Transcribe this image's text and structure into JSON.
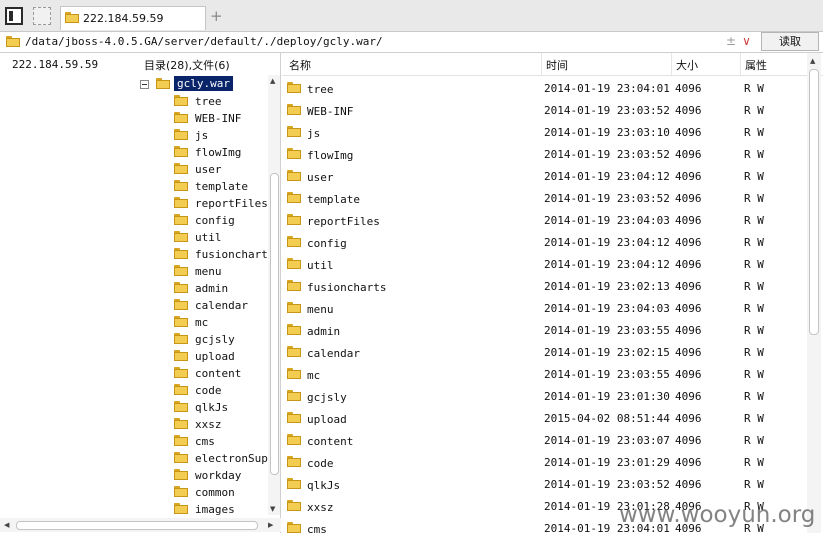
{
  "tab": {
    "title": "222.184.59.59"
  },
  "address": {
    "path": "/data/jboss-4.0.5.GA/server/default/./deploy/gcly.war/",
    "read_button": "读取"
  },
  "tree": {
    "host": "222.184.59.59",
    "counts": "目录(28),文件(6)",
    "root": "gcly.war",
    "items": [
      "tree",
      "WEB-INF",
      "js",
      "flowImg",
      "user",
      "template",
      "reportFiles",
      "config",
      "util",
      "fusioncharts",
      "menu",
      "admin",
      "calendar",
      "mc",
      "gcjsly",
      "upload",
      "content",
      "code",
      "qlkJs",
      "xxsz",
      "cms",
      "electronSuper",
      "workday",
      "common",
      "images"
    ]
  },
  "columns": {
    "name": "名称",
    "time": "时间",
    "size": "大小",
    "attr": "属性"
  },
  "files": [
    {
      "name": "tree",
      "time": "2014-01-19 23:04:01",
      "size": "4096",
      "attr": "R W"
    },
    {
      "name": "WEB-INF",
      "time": "2014-01-19 23:03:52",
      "size": "4096",
      "attr": "R W"
    },
    {
      "name": "js",
      "time": "2014-01-19 23:03:10",
      "size": "4096",
      "attr": "R W"
    },
    {
      "name": "flowImg",
      "time": "2014-01-19 23:03:52",
      "size": "4096",
      "attr": "R W"
    },
    {
      "name": "user",
      "time": "2014-01-19 23:04:12",
      "size": "4096",
      "attr": "R W"
    },
    {
      "name": "template",
      "time": "2014-01-19 23:03:52",
      "size": "4096",
      "attr": "R W"
    },
    {
      "name": "reportFiles",
      "time": "2014-01-19 23:04:03",
      "size": "4096",
      "attr": "R W"
    },
    {
      "name": "config",
      "time": "2014-01-19 23:04:12",
      "size": "4096",
      "attr": "R W"
    },
    {
      "name": "util",
      "time": "2014-01-19 23:04:12",
      "size": "4096",
      "attr": "R W"
    },
    {
      "name": "fusioncharts",
      "time": "2014-01-19 23:02:13",
      "size": "4096",
      "attr": "R W"
    },
    {
      "name": "menu",
      "time": "2014-01-19 23:04:03",
      "size": "4096",
      "attr": "R W"
    },
    {
      "name": "admin",
      "time": "2014-01-19 23:03:55",
      "size": "4096",
      "attr": "R W"
    },
    {
      "name": "calendar",
      "time": "2014-01-19 23:02:15",
      "size": "4096",
      "attr": "R W"
    },
    {
      "name": "mc",
      "time": "2014-01-19 23:03:55",
      "size": "4096",
      "attr": "R W"
    },
    {
      "name": "gcjsly",
      "time": "2014-01-19 23:01:30",
      "size": "4096",
      "attr": "R W"
    },
    {
      "name": "upload",
      "time": "2015-04-02 08:51:44",
      "size": "4096",
      "attr": "R W"
    },
    {
      "name": "content",
      "time": "2014-01-19 23:03:07",
      "size": "4096",
      "attr": "R W"
    },
    {
      "name": "code",
      "time": "2014-01-19 23:01:29",
      "size": "4096",
      "attr": "R W"
    },
    {
      "name": "qlkJs",
      "time": "2014-01-19 23:03:52",
      "size": "4096",
      "attr": "R W"
    },
    {
      "name": "xxsz",
      "time": "2014-01-19 23:01:28",
      "size": "4096",
      "attr": "R W"
    },
    {
      "name": "cms",
      "time": "2014-01-19 23:04:01",
      "size": "4096",
      "attr": "R W"
    }
  ],
  "watermark": "www.wooyun.org",
  "colors": {
    "selection": "#0a246a",
    "folder": "#f3cd52",
    "folder_border": "#c89616"
  },
  "icons": {
    "folder": "folder-icon",
    "add_tab": "plus-icon",
    "collapse": "minus-icon"
  }
}
